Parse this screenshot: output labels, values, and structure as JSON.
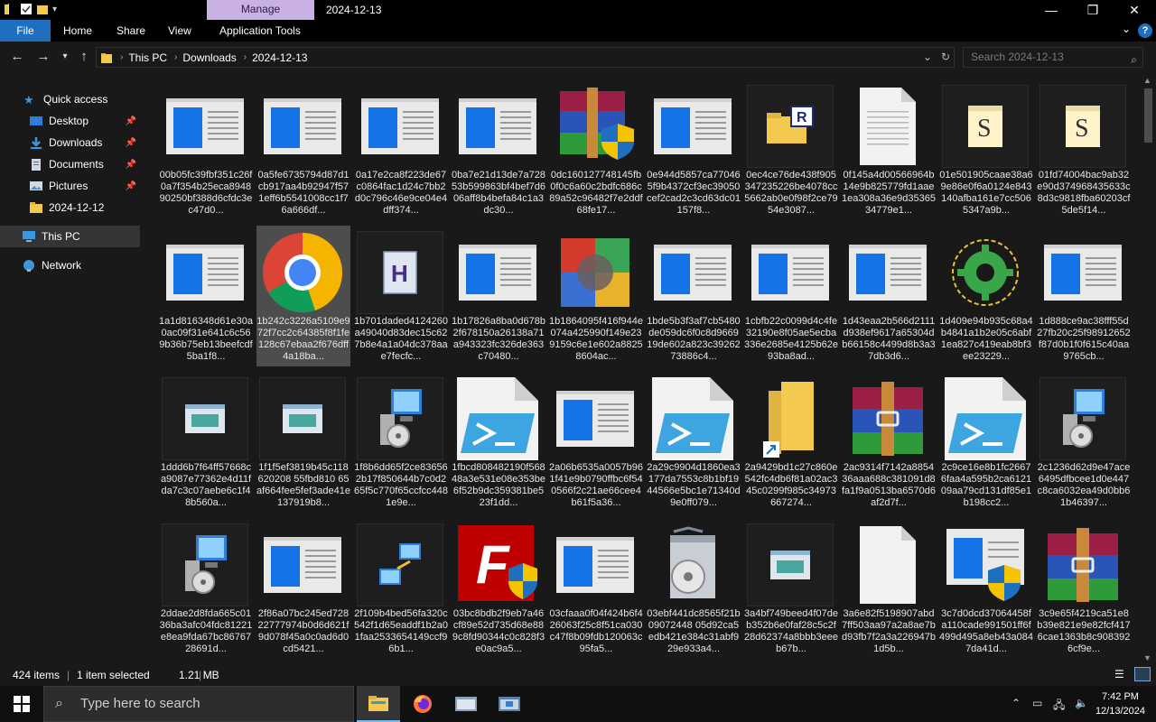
{
  "window": {
    "title": "2024-12-13",
    "manage_tab": "Manage",
    "minimize": "—",
    "maximize": "❐",
    "close": "✕"
  },
  "ribbon": {
    "file": "File",
    "tabs": [
      "Home",
      "Share",
      "View",
      "Application Tools"
    ]
  },
  "address": {
    "crumbs": [
      "This PC",
      "Downloads",
      "2024-12-13"
    ]
  },
  "search": {
    "placeholder": "Search 2024-12-13"
  },
  "sidebar": {
    "quick_access": "Quick access",
    "items": [
      {
        "label": "Desktop",
        "pinned": true
      },
      {
        "label": "Downloads",
        "pinned": true
      },
      {
        "label": "Documents",
        "pinned": true
      },
      {
        "label": "Pictures",
        "pinned": true
      },
      {
        "label": "2024-12-12",
        "pinned": false
      }
    ],
    "this_pc": "This PC",
    "network": "Network"
  },
  "files": [
    {
      "name": "00b05fc39fbf351c26f0a7f354b25eca894890250bf388d6cfdc3ec47d0...",
      "icon": "window"
    },
    {
      "name": "0a5fe6735794d87d1cb917aa4b92947f571eff6b5541008cc1f76a666df...",
      "icon": "window"
    },
    {
      "name": "0a17e2ca8f223de67c0864fac1d24c7bb2d0c796c46e9ce04e4dff374...",
      "icon": "window"
    },
    {
      "name": "0ba7e21d13de7a72853b599863bf4bef7d606aff8b4befa84c1a3dc30...",
      "icon": "window"
    },
    {
      "name": "0dc160127748145fb0f0c6a60c2bdfc686c89a52c96482f7e2ddf68fe17...",
      "icon": "winrar-shield"
    },
    {
      "name": "0e944d5857ca770465f9b4372cf3ec39050cef2cad2c3cd63dc01157f8...",
      "icon": "window"
    },
    {
      "name": "0ec4ce76de438f905347235226be4078cc5662ab0e0f98f2ce7954e3087...",
      "icon": "registry"
    },
    {
      "name": "0f145a4d00566964b14e9b825779fd1aae1ea308a36e9d3536534779e1...",
      "icon": "document"
    },
    {
      "name": "01e501905caae38a69e86e0f6a0124e843140afba161e7cc5065347a9b...",
      "icon": "script"
    },
    {
      "name": "01fd74004bac9ab32e90d374968435633c8d3c9818fba60203cf5de5f14...",
      "icon": "script"
    },
    {
      "name": "1a1d816348d61e30a0ac09f31e641c6c569b36b75eb13beefcdf5ba1f8...",
      "icon": "window"
    },
    {
      "name": "1b242c3226a5109e972f7cc2c64385f8f1fe128c67ebaa2f676dff4a18ba...",
      "icon": "chrome",
      "selected": true
    },
    {
      "name": "1b701daded4124260a49040d83dec15c627b8e4a1a04dc378aae7fecfc...",
      "icon": "hfile"
    },
    {
      "name": "1b17826a8ba0d678b2f678150a26138a71a943323fc326de363c70480...",
      "icon": "window"
    },
    {
      "name": "1b1864095f416f944e074a425990f149e239159c6e1e602a88258604ac...",
      "icon": "colorful"
    },
    {
      "name": "1bde5b3f3af7cb5480de059dc6f0c8d966919de602a823c3926273886c4...",
      "icon": "window"
    },
    {
      "name": "1cbfb22c0099d4c4fe32190e8f05ae5ecba336e2685e4125b62e93ba8ad...",
      "icon": "window"
    },
    {
      "name": "1d43eaa2b566d2111d938ef9617a65304db66158c4499d8b3a37db3d6...",
      "icon": "window"
    },
    {
      "name": "1d409e94b935c68a4b4841a1b2e05c6abf1ea827c419eab8bf3ee23229...",
      "icon": "gear"
    },
    {
      "name": "1d888ce9ac38fff55d27fb20c25f98912652f87d0b1f0f615c40aa9765cb...",
      "icon": "window"
    },
    {
      "name": "1ddd6b7f64ff57668ca9087e77362e4d11fda7c3c07aebe6c1f48b560a...",
      "icon": "dialog-dark"
    },
    {
      "name": "1f1f5ef3819b45c118620208 55fbd810 65af664fee5fef3ade41e137919b8...",
      "icon": "dialog-dark"
    },
    {
      "name": "1f8b6dd65f2ce836562b17f850644b7c0d265f5c770f65ccfcc4481e9e...",
      "icon": "setup"
    },
    {
      "name": "1fbcd808482190f56848a3e531e08e353be6f52b9dc359381be523f1dd...",
      "icon": "powershell"
    },
    {
      "name": "2a06b6535a0057b961f41e9b0790ffbc6f540566f2c21ae66cee4b61f5a36...",
      "icon": "window"
    },
    {
      "name": "2a29c9904d1860ea3177da7553c8b1bf1944566e5bc1e71340d9e0ff079...",
      "icon": "powershell"
    },
    {
      "name": "2a9429bd1c27c860e542fc4db6f81a02ac345c0299f985c34973667274...",
      "icon": "folder-shortcut"
    },
    {
      "name": "2ac9314f7142a885436aaa688c381091d8fa1f9a0513ba6570d6af2d7f...",
      "icon": "winrar"
    },
    {
      "name": "2c9ce16e8b1fc26676faa4a595b2ca612109aa79cd131df85e1b198cc2...",
      "icon": "powershell"
    },
    {
      "name": "2c1236d62d9e47ace6495dfbcee1d0e447c8ca6032ea49d0bb61b46397...",
      "icon": "setup"
    },
    {
      "name": "2ddae2d8fda665c0136ba3afc04fdc81221e8ea9fda67bc8676728691d...",
      "icon": "setup"
    },
    {
      "name": "2f86a07bc245ed72822777974b0d6d621f9d078f45a0c0ad6d0cd5421...",
      "icon": "window"
    },
    {
      "name": "2f109b4bed56fa320c542f1d65eaddf1b2a01faa2533654149ccf96b1...",
      "icon": "network"
    },
    {
      "name": "03bc8bdb2f9eb7a46cf89e52d735d68e889c8fd90344c0c828f3e0ac9a5...",
      "icon": "filezilla"
    },
    {
      "name": "03cfaaa0f04f424b6f426063f25c8f51ca030c47f8b09fdb120063c95fa5...",
      "icon": "window"
    },
    {
      "name": "03ebf441dc8565f21b09072448 05d92ca5edb421e384c31abf929e933a4...",
      "icon": "installer"
    },
    {
      "name": "3a4bf749beed4f07deb352b6e0faf28c5c2f28d62374a8bbb3eeeb67b...",
      "icon": "dialog-dark"
    },
    {
      "name": "3a6e82f5198907abd7ff503aa97a2a8ae7bd93fb7f2a3a226947b1d5b...",
      "icon": "blank"
    },
    {
      "name": "3c7d0dcd37064458fa110cade991501ff6f499d495a8eb43a0847da41d...",
      "icon": "window-shield"
    },
    {
      "name": "3c9e65f4219ca51e8b39e821e9e82fcf4176cae1363b8c9083926cf9e...",
      "icon": "winrar"
    }
  ],
  "status": {
    "count": "424 items",
    "selected": "1 item selected",
    "size": "1.21 MB"
  },
  "taskbar": {
    "search_placeholder": "Type here to search",
    "time": "7:42 PM",
    "date": "12/13/2024"
  }
}
